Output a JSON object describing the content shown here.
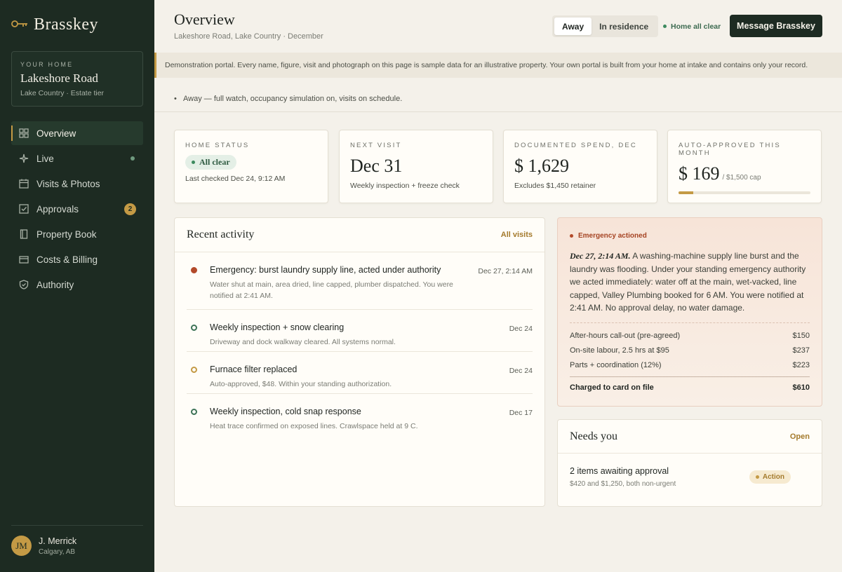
{
  "brand": {
    "name": "Brasskey",
    "icon": "key-icon"
  },
  "home_card": {
    "eyebrow": "YOUR HOME",
    "name": "Lakeshore Road",
    "sub": "Lake Country · Estate tier"
  },
  "nav": [
    {
      "label": "Overview",
      "icon": "grid-icon",
      "active": true
    },
    {
      "label": "Live",
      "icon": "sparkle-icon",
      "indicator": "dot"
    },
    {
      "label": "Visits & Photos",
      "icon": "calendar-icon"
    },
    {
      "label": "Approvals",
      "icon": "checkbox-icon",
      "badge": "2"
    },
    {
      "label": "Property Book",
      "icon": "book-icon"
    },
    {
      "label": "Costs & Billing",
      "icon": "card-icon"
    },
    {
      "label": "Authority",
      "icon": "shield-icon"
    }
  ],
  "user": {
    "initials": "JM",
    "name": "J. Merrick",
    "location": "Calgary, AB"
  },
  "header": {
    "title": "Overview",
    "sub": "Lakeshore Road, Lake Country · December",
    "mode_options": [
      "Away",
      "In residence"
    ],
    "mode_selected": "Away",
    "status": "Home all clear",
    "message_button": "Message Brasskey"
  },
  "banner": "Demonstration portal. Every name, figure, visit and photograph on this page is sample data for an illustrative property. Your own portal is built from your home at intake and contains only your record.",
  "away_line": "Away — full watch, occupancy simulation on, visits on schedule.",
  "stats": {
    "home_status": {
      "label": "HOME STATUS",
      "chip": "All clear",
      "sub": "Last checked Dec 24, 9:12 AM"
    },
    "next_visit": {
      "label": "NEXT VISIT",
      "value": "Dec 31",
      "sub": "Weekly inspection + freeze check"
    },
    "spend": {
      "label": "DOCUMENTED SPEND, DEC",
      "value": "$ 1,629",
      "sub": "Excludes $1,450 retainer"
    },
    "auto_approved": {
      "label": "AUTO-APPROVED THIS MONTH",
      "value": "$ 169",
      "cap": "/ $1,500 cap",
      "progress": 0.113
    }
  },
  "activity": {
    "title": "Recent activity",
    "link": "All visits",
    "items": [
      {
        "title": "Emergency: burst laundry supply line, acted under authority",
        "desc": "Water shut at main, area dried, line capped, plumber dispatched. You were notified at 2:41 AM.",
        "date": "Dec 27, 2:14 AM",
        "marker": "filled"
      },
      {
        "title": "Weekly inspection + snow clearing",
        "desc": "Driveway and dock walkway cleared. All systems normal.",
        "date": "Dec 24",
        "marker": "ring-green"
      },
      {
        "title": "Furnace filter replaced",
        "desc": "Auto-approved, $48. Within your standing authorization.",
        "date": "Dec 24",
        "marker": "ring-gold"
      },
      {
        "title": "Weekly inspection, cold snap response",
        "desc": "Heat trace confirmed on exposed lines. Crawlspace held at 9 C.",
        "date": "Dec 17",
        "marker": "ring-green"
      }
    ]
  },
  "emergency": {
    "tag": "Emergency actioned",
    "lead": "Dec 27, 2:14 AM.",
    "text": " A washing-machine supply line burst and the laundry was flooding. Under your standing emergency authority we acted immediately: water off at the main, wet-vacked, line capped, Valley Plumbing booked for 6 AM. You were notified at 2:41 AM. No approval delay, no water damage.",
    "rows": [
      {
        "label": "After-hours call-out (pre-agreed)",
        "amount": "$150"
      },
      {
        "label": "On-site labour, 2.5 hrs at $95",
        "amount": "$237"
      },
      {
        "label": "Parts + coordination (12%)",
        "amount": "$223"
      }
    ],
    "total_label": "Charged to card on file",
    "total_amount": "$610"
  },
  "needs": {
    "title": "Needs you",
    "link": "Open",
    "item_title": "2 items awaiting approval",
    "item_sub": "$420 and $1,250, both non-urgent",
    "chip": "Action"
  },
  "colors": {
    "sidebar": "#1d2b22",
    "accent": "#c49a45",
    "alert": "#b34a2a",
    "ok": "#3c8a5e"
  }
}
